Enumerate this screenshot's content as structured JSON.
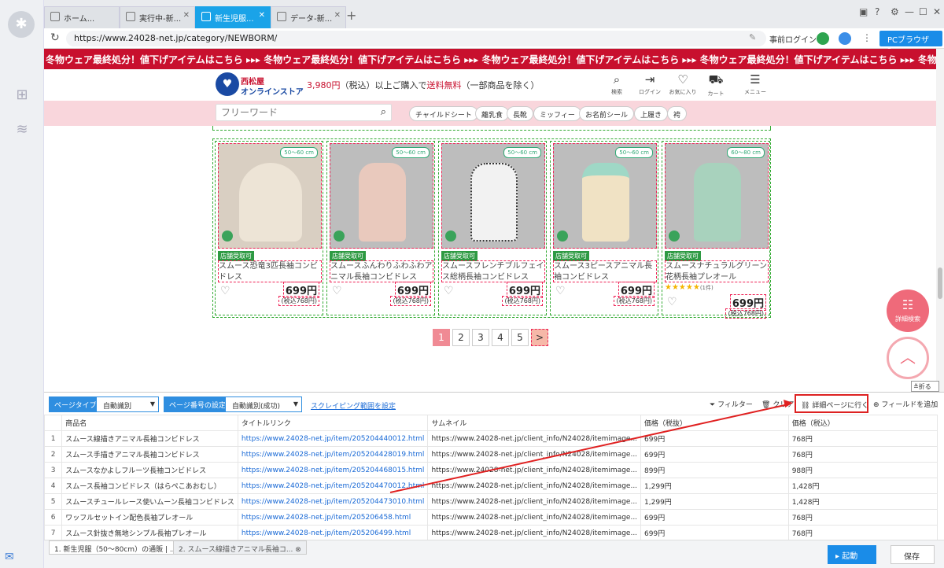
{
  "tabs": [
    {
      "label": "ホーム..."
    },
    {
      "label": "実行中-新..."
    },
    {
      "label": "新生児服..."
    },
    {
      "label": "データ-新..."
    }
  ],
  "address": {
    "url": "https://www.24028-net.jp/category/NEWBORM/",
    "login": "事前ログイン",
    "browser_mode": "PCブラウザ"
  },
  "banner": "冬物ウェア最終処分！値下げアイテムはこちら ▸▸▸ 冬物ウェア最終処分！値下げアイテムはこちら ▸▸▸ 冬物ウェア最終処分！値下げアイテムはこちら ▸▸▸ 冬物ウェア最終処分！値下げアイテムはこちら ▸▸▸ 冬物ウェア最終処分！値下げアイテムはこちら",
  "site": {
    "name_line1": "西松屋",
    "name_line2": "オンラインストア",
    "promo_price": "3,980円",
    "promo_middle": "（税込）以上ご購入で",
    "promo_free": "送料無料",
    "promo_end": "（一部商品を除く）",
    "nav": [
      {
        "label": "検索"
      },
      {
        "label": "ログイン"
      },
      {
        "label": "お気に入り"
      },
      {
        "label": "カート"
      },
      {
        "label": "メニュー"
      }
    ],
    "search_placeholder": "フリーワード",
    "chips": [
      "チャイルドシート",
      "離乳食",
      "長靴",
      "ミッフィー",
      "お名前シール",
      "上履き",
      "袴"
    ]
  },
  "products": [
    {
      "size": "50～60 cm",
      "store": "店舗受取可",
      "name": "スムース恐竜3匹長袖コンビドレス",
      "price": "699円",
      "tax": "(税込768円)",
      "color": "#ede4d6"
    },
    {
      "size": "50～60 cm",
      "store": "店舗受取可",
      "name": "スムースふんわりふわふわアニマル長袖コンビドレス",
      "price": "699円",
      "tax": "(税込768円)",
      "color": "#e9c9bd"
    },
    {
      "size": "50～60 cm",
      "store": "店舗受取可",
      "name": "スムースフレンチブルフェイス総柄長袖コンビドレス",
      "price": "699円",
      "tax": "(税込768円)",
      "color": "#f2f2f2"
    },
    {
      "size": "50～60 cm",
      "store": "店舗受取可",
      "name": "スムース3ピースアニマル長袖コンビドレス",
      "price": "699円",
      "tax": "(税込768円)",
      "color": "#f0e2c4"
    },
    {
      "size": "60～80 cm",
      "store": "店舗受取可",
      "name": "スムースナチュラルグリーン花柄長袖プレオール",
      "price": "699円",
      "tax": "(税込768円)",
      "color": "#a8d2bd",
      "stars": "★★★★★",
      "review_count": "(1件)"
    }
  ],
  "pager": {
    "pages": [
      "1",
      "2",
      "3",
      "4",
      "5"
    ],
    "next": ">"
  },
  "fab": {
    "detail_search": "詳細検索"
  },
  "panel": {
    "fold": "折る",
    "page_type_label": "ページタイプ",
    "page_type_value": "自動識別",
    "page_num_label": "ページ番号の設定",
    "page_num_value": "自動識別(成功)",
    "scrape_range": "スクレイピング範囲を設定",
    "filter": "フィルター",
    "clear": "クリア",
    "goto_detail": "詳細ページに行く",
    "add_field": "フィールドを追加",
    "columns": [
      "",
      "商品名",
      "タイトルリンク",
      "サムネイル",
      "価格（税抜）",
      "価格（税込）"
    ],
    "rows": [
      [
        "1",
        "スムース線描きアニマル長袖コンビドレス",
        "https://www.24028-net.jp/item/205204440012.html",
        "https://www.24028-net.jp/client_info/N24028/itemimage...",
        "699円",
        "768円"
      ],
      [
        "2",
        "スムース手描きアニマル長袖コンビドレス",
        "https://www.24028-net.jp/item/205204428019.html",
        "https://www.24028-net.jp/client_info/N24028/itemimage...",
        "699円",
        "768円"
      ],
      [
        "3",
        "スムースなかよしフルーツ長袖コンビドレス",
        "https://www.24028-net.jp/item/205204468015.html",
        "https://www.24028-net.jp/client_info/N24028/itemimage...",
        "899円",
        "988円"
      ],
      [
        "4",
        "スムース長袖コンビドレス（はらぺこあおむし）",
        "https://www.24028-net.jp/item/205204470012.html",
        "https://www.24028-net.jp/client_info/N24028/itemimage...",
        "1,299円",
        "1,428円"
      ],
      [
        "5",
        "スムースチュールレース使いムーン長袖コンビドレス",
        "https://www.24028-net.jp/item/205204473010.html",
        "https://www.24028-net.jp/client_info/N24028/itemimage...",
        "1,299円",
        "1,428円"
      ],
      [
        "6",
        "ワッフルセットイン配色長袖プレオール",
        "https://www.24028-net.jp/item/205206458.html",
        "https://www.24028-net.jp/client_info/N24028/itemimage...",
        "699円",
        "768円"
      ],
      [
        "7",
        "スムース針抜き無地シンプル長袖プレオール",
        "https://www.24028-net.jp/item/205206499.html",
        "https://www.24028-net.jp/client_info/N24028/itemimage...",
        "699円",
        "768円"
      ]
    ]
  },
  "bottom": {
    "task_tab_1": "1. 新生児服（50～80cm）の通販 | ...",
    "task_tab_2": "2. スムース線描きアニマル長袖コ...",
    "run": "起動",
    "save": "保存"
  },
  "colors": {
    "accent": "#1a8ce8",
    "banner": "#c8102e",
    "pink": "#f9d6dc",
    "highlight": "#dd2222"
  }
}
